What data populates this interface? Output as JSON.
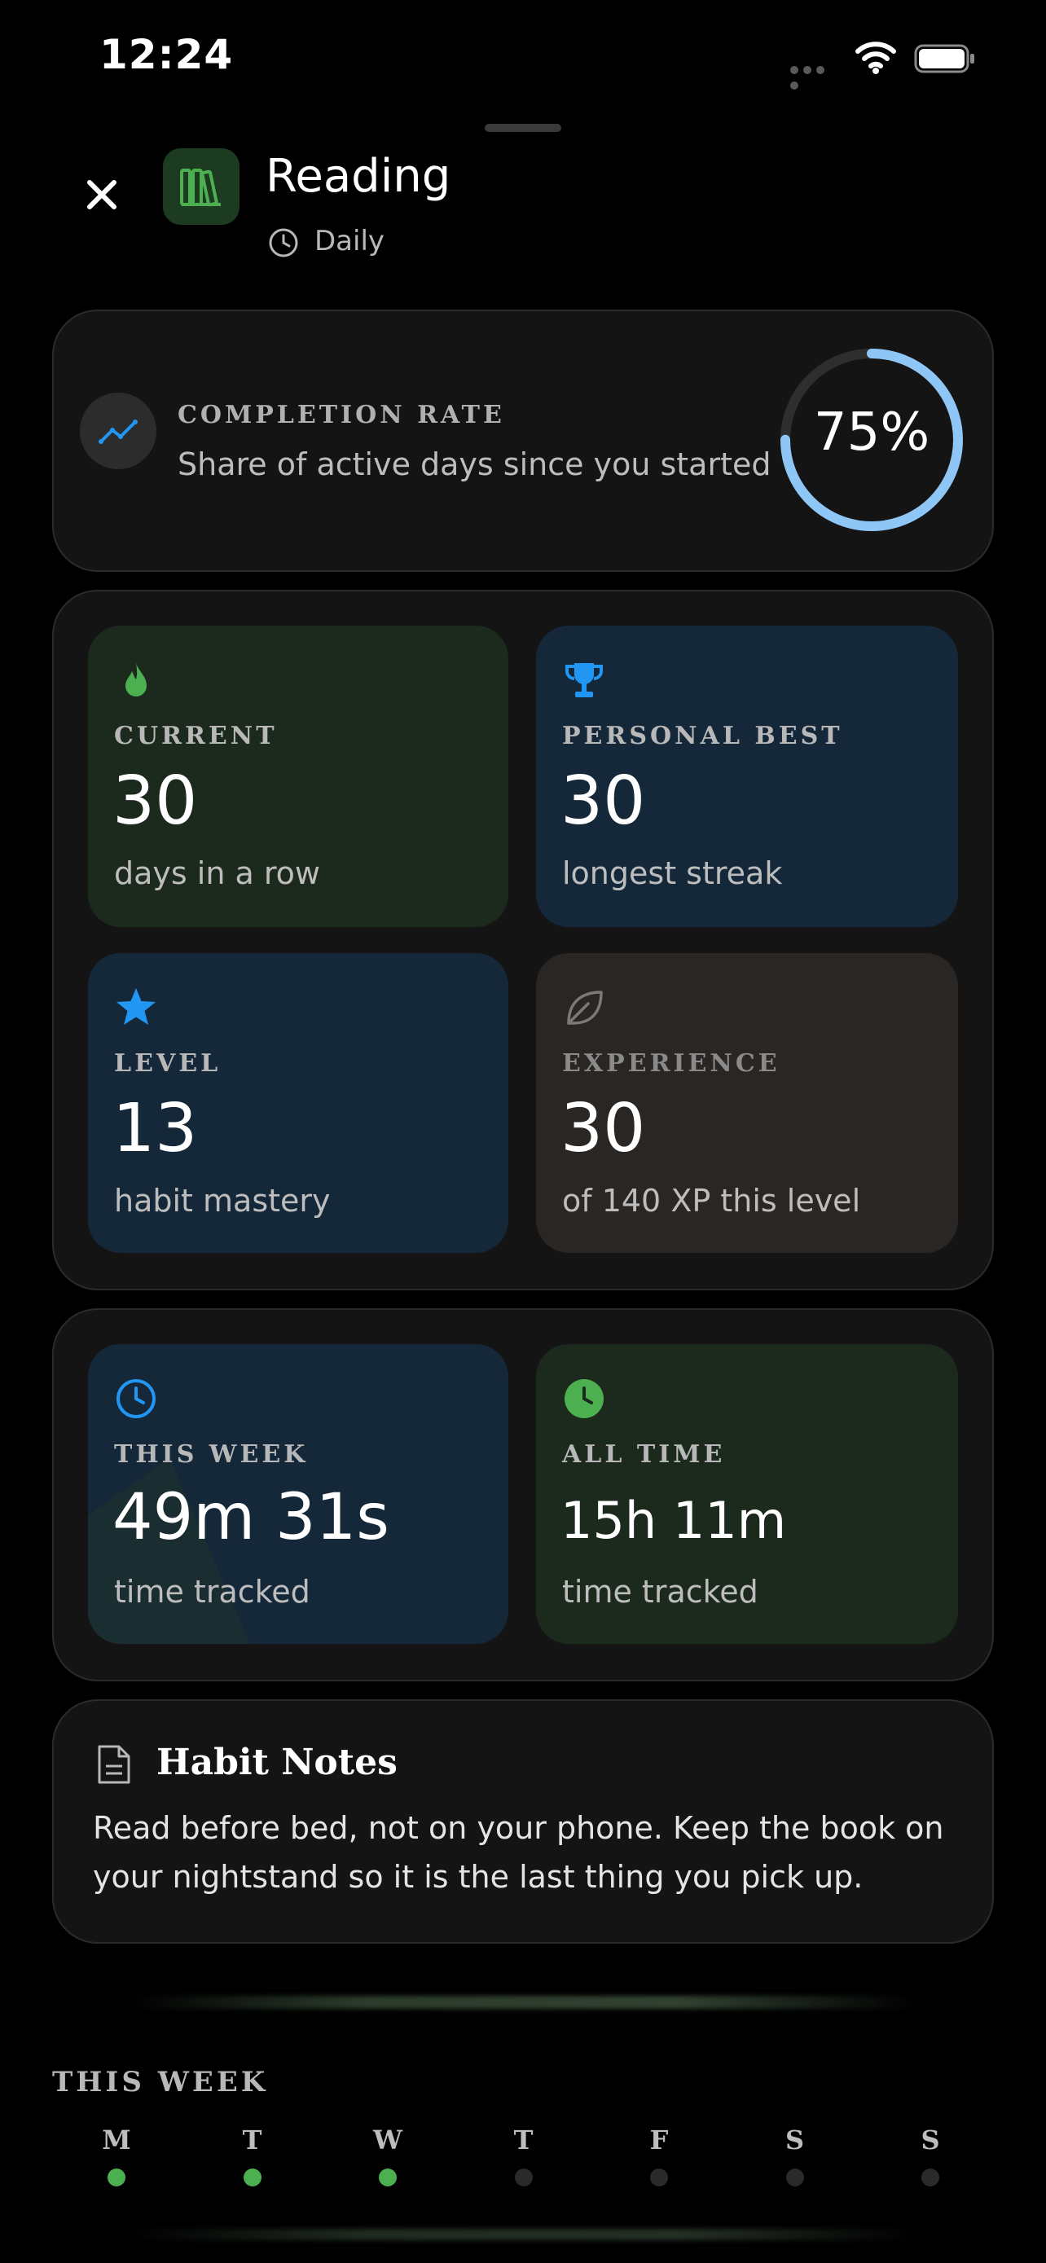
{
  "status_bar": {
    "time": "12:24"
  },
  "header": {
    "title": "Reading",
    "frequency": "Daily"
  },
  "completion": {
    "label": "COMPLETION RATE",
    "description": "Share of active days since you started",
    "percent_text": "75%",
    "value": 0.75,
    "ring_color": "#8ec7f5"
  },
  "stats": [
    {
      "label": "CURRENT",
      "value": "30",
      "sub": "days in a row",
      "icon": "flame-icon",
      "color": "#4caf50"
    },
    {
      "label": "PERSONAL BEST",
      "value": "30",
      "sub": "longest streak",
      "icon": "trophy-icon",
      "color": "#2196f3"
    },
    {
      "label": "LEVEL",
      "value": "13",
      "sub": "habit mastery",
      "icon": "star-icon",
      "color": "#2196f3"
    },
    {
      "label": "EXPERIENCE",
      "value": "30",
      "sub": "of 140 XP this level",
      "icon": "leaf-icon",
      "color": "#7a7a7a"
    }
  ],
  "time_tracked": [
    {
      "label": "THIS WEEK",
      "value": "49m 31s",
      "sub": "time tracked",
      "icon": "clock-outline-icon",
      "color": "#2196f3"
    },
    {
      "label": "ALL TIME",
      "value": "15h 11m",
      "sub": "time tracked",
      "icon": "clock-filled-icon",
      "color": "#4caf50"
    }
  ],
  "notes": {
    "title": "Habit Notes",
    "body": "Read before bed, not on your phone. Keep the book on your nightstand so it is the last thing you pick up."
  },
  "week": {
    "title": "THIS WEEK",
    "days": [
      {
        "label": "M",
        "done": true
      },
      {
        "label": "T",
        "done": true
      },
      {
        "label": "W",
        "done": true
      },
      {
        "label": "T",
        "done": false
      },
      {
        "label": "F",
        "done": false
      },
      {
        "label": "S",
        "done": false
      },
      {
        "label": "S",
        "done": false
      }
    ],
    "done_color": "#4caf50",
    "empty_color": "#2a2a2a"
  }
}
